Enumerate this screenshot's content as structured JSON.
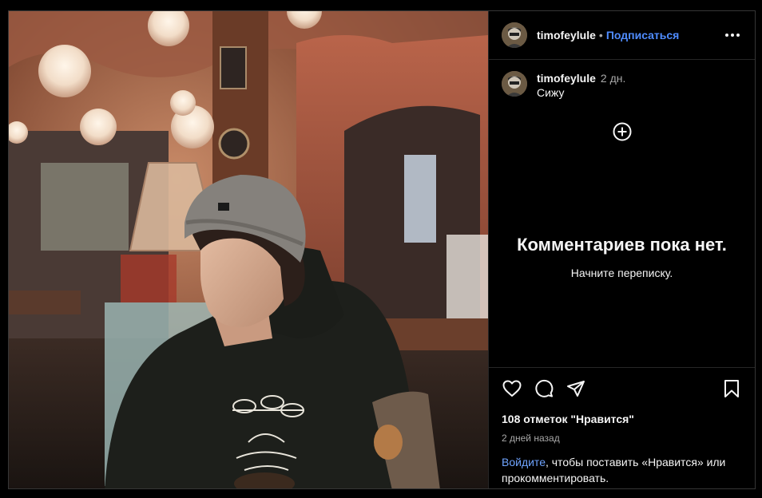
{
  "post": {
    "username": "timofeylule",
    "follow_label": "Подписаться",
    "dot": "•",
    "caption_time": "2 дн.",
    "caption_text": "Сижу"
  },
  "comments": {
    "empty_title": "Комментариев пока нет.",
    "empty_subtitle": "Начните переписку."
  },
  "footer": {
    "likes_text": "108 отметок \"Нравится\"",
    "posted_ago": "2 дней назад",
    "login_link": "Войдите",
    "login_rest": ", чтобы поставить «Нравится» или прокомментировать."
  },
  "icons": {
    "more": "more-horizontal-icon",
    "add_comment": "plus-circle-icon",
    "like": "heart-icon",
    "comment": "comment-icon",
    "share": "send-icon",
    "save": "bookmark-icon"
  },
  "colors": {
    "background": "#000000",
    "text": "#f5f5f5",
    "muted": "#a8a8a8",
    "link": "#4f8cff",
    "border": "#262626"
  }
}
